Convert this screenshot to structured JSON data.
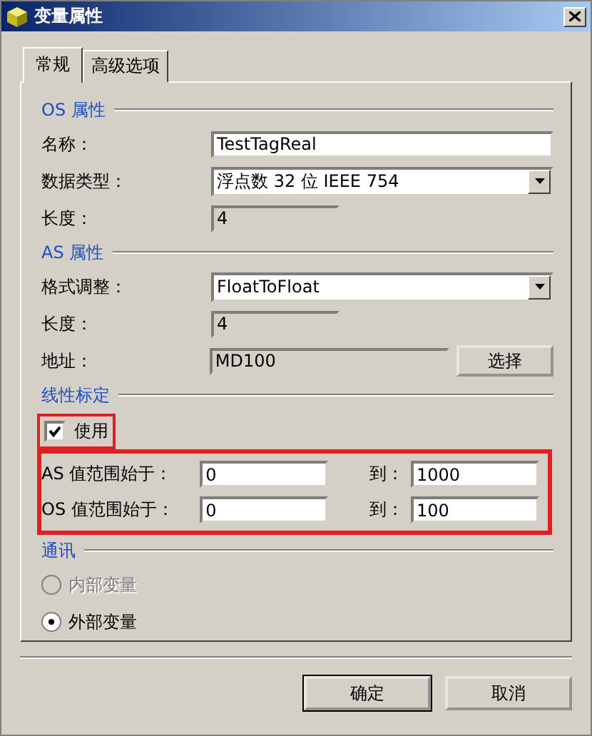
{
  "window": {
    "title": "变量属性"
  },
  "tabs": [
    {
      "label": "常规",
      "selected": true
    },
    {
      "label": "高级选项",
      "selected": false
    }
  ],
  "os_section": {
    "title": "OS 属性",
    "rows": [
      {
        "kind": "text",
        "label": "名称：",
        "value": "TestTagReal"
      },
      {
        "kind": "combo",
        "label": "数据类型：",
        "value": "浮点数 32 位 IEEE 754"
      },
      {
        "kind": "readonly",
        "label": "长度：",
        "value": "4"
      }
    ]
  },
  "as_section": {
    "title": "AS 属性",
    "rows": [
      {
        "kind": "combo",
        "label": "格式调整：",
        "value": "FloatToFloat"
      },
      {
        "kind": "readonly",
        "label": "长度：",
        "value": "4"
      },
      {
        "kind": "readonly_button",
        "label": "地址：",
        "value": "MD100",
        "button": "选择"
      }
    ]
  },
  "scaling": {
    "title": "线性标定",
    "enable": {
      "label": "使用",
      "checked": true,
      "highlighted": true
    },
    "ranges": {
      "highlighted": true,
      "rows": [
        {
          "label": "AS 值范围始于：",
          "from": "0",
          "to_label": "到：",
          "to": "1000"
        },
        {
          "label": "OS 值范围始于：",
          "from": "0",
          "to_label": "到：",
          "to": "100"
        }
      ]
    }
  },
  "comm": {
    "title": "通讯",
    "options": [
      {
        "label": "内部变量",
        "selected": false,
        "disabled": true
      },
      {
        "label": "外部变量",
        "selected": true,
        "disabled": false
      }
    ]
  },
  "buttons": [
    "确定",
    "取消"
  ]
}
